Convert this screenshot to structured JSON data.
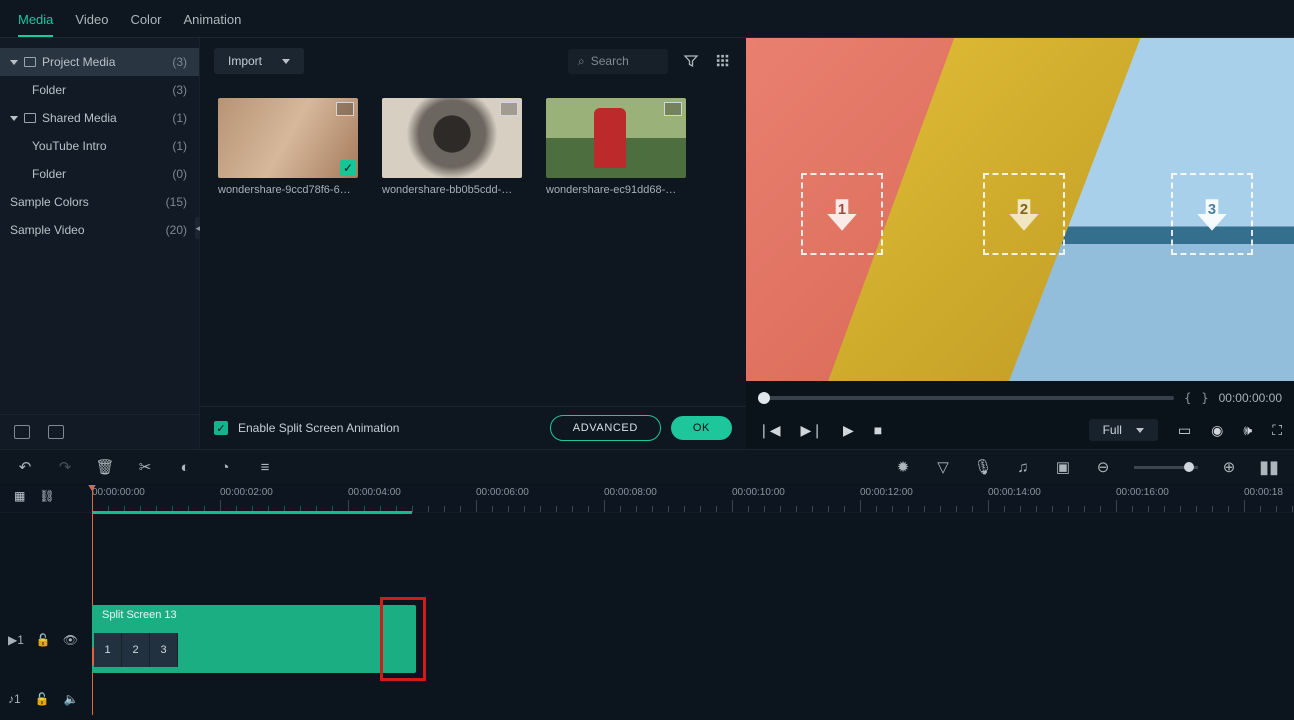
{
  "tabs": {
    "media": "Media",
    "video": "Video",
    "color": "Color",
    "animation": "Animation"
  },
  "sidebar": {
    "projectMedia": {
      "label": "Project Media",
      "count": "(3)"
    },
    "folder1": {
      "label": "Folder",
      "count": "(3)"
    },
    "sharedMedia": {
      "label": "Shared Media",
      "count": "(1)"
    },
    "youtubeIntro": {
      "label": "YouTube Intro",
      "count": "(1)"
    },
    "folder2": {
      "label": "Folder",
      "count": "(0)"
    },
    "sampleColors": {
      "label": "Sample Colors",
      "count": "(15)"
    },
    "sampleVideo": {
      "label": "Sample Video",
      "count": "(20)"
    }
  },
  "media": {
    "import": "Import",
    "search": "Search",
    "items": [
      {
        "label": "wondershare-9ccd78f6-6…"
      },
      {
        "label": "wondershare-bb0b5cdd-…"
      },
      {
        "label": "wondershare-ec91dd68-…"
      }
    ]
  },
  "controls": {
    "enableSplit": "Enable Split Screen Animation",
    "advanced": "ADVANCED",
    "ok": "OK"
  },
  "preview": {
    "timestamp": "00:00:00:00",
    "fullLabel": "Full",
    "num1": "1",
    "num2": "2",
    "num3": "3"
  },
  "timeline": {
    "marks": [
      "00:00:00:00",
      "00:00:02:00",
      "00:00:04:00",
      "00:00:06:00",
      "00:00:08:00",
      "00:00:10:00",
      "00:00:12:00",
      "00:00:14:00",
      "00:00:16:00",
      "00:00:18"
    ],
    "clipTitle": "Split Screen 13",
    "pins": [
      "1",
      "2",
      "3"
    ],
    "videoTrack": "1",
    "audioTrack": "1"
  }
}
